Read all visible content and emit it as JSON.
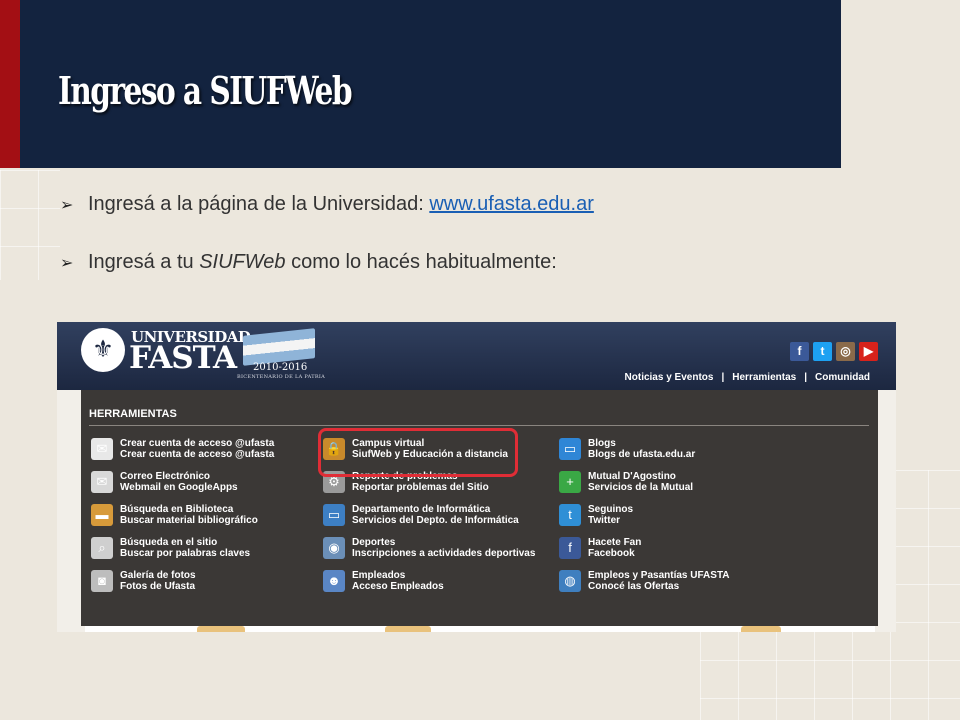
{
  "slide": {
    "title": "Ingreso a SIUFWeb",
    "bullet1_text": "Ingresá a la página de la Universidad: ",
    "bullet1_link": "www.ufasta.edu.ar",
    "bullet2_pre": "Ingresá a tu ",
    "bullet2_em": "SIUFWeb",
    "bullet2_post": " como lo hacés habitualmente:"
  },
  "site": {
    "logo_top": "UNIVERSIDAD",
    "logo_main": "FASTA",
    "years": "2010-2016",
    "bicentenario": "BICENTENARIO DE LA PATRIA",
    "social": [
      "f",
      "t",
      "◎",
      "▶"
    ],
    "nav": [
      "Noticias y Eventos",
      "Herramientas",
      "Comunidad"
    ],
    "nav_sep": "|",
    "menu_title": "HERRAMIENTAS",
    "items": [
      {
        "l1": "Crear cuenta de acceso @ufasta",
        "l2": "Crear cuenta de acceso @ufasta",
        "icon": "envelope-add-icon",
        "glyph": "✉",
        "color": "#e8e8e8"
      },
      {
        "l1": "Correo Electrónico",
        "l2": "Webmail en GoogleApps",
        "icon": "envelope-icon",
        "glyph": "✉",
        "color": "#d8d8d8"
      },
      {
        "l1": "Búsqueda en Biblioteca",
        "l2": "Buscar material bibliográfico",
        "icon": "folder-icon",
        "glyph": "▬",
        "color": "#d79a3a"
      },
      {
        "l1": "Búsqueda en el sitio",
        "l2": "Buscar por palabras claves",
        "icon": "search-doc-icon",
        "glyph": "⌕",
        "color": "#cfcfcf"
      },
      {
        "l1": "Galería de fotos",
        "l2": "Fotos de Ufasta",
        "icon": "camera-icon",
        "glyph": "◙",
        "color": "#bdbdbd"
      },
      {
        "l1": "Campus virtual",
        "l2": "SiufWeb y Educación a distancia",
        "icon": "lock-icon",
        "glyph": "🔒",
        "color": "#c98a2b"
      },
      {
        "l1": "Reporte de problemas",
        "l2": "Reportar problemas del Sitio",
        "icon": "gears-icon",
        "glyph": "⚙",
        "color": "#9a9a9a"
      },
      {
        "l1": "Departamento de Informática",
        "l2": "Servicios del Depto. de Informática",
        "icon": "monitor-icon",
        "glyph": "▭",
        "color": "#3d7fc4"
      },
      {
        "l1": "Deportes",
        "l2": "Inscripciones a actividades deportivas",
        "icon": "disc-icon",
        "glyph": "◉",
        "color": "#6b8fb8"
      },
      {
        "l1": "Empleados",
        "l2": "Acceso Empleados",
        "icon": "user-icon",
        "glyph": "☻",
        "color": "#5a86c5"
      },
      {
        "l1": "Blogs",
        "l2": "Blogs de ufasta.edu.ar",
        "icon": "chat-bubble-icon",
        "glyph": "▭",
        "color": "#2f86d6"
      },
      {
        "l1": "Mutual D'Agostino",
        "l2": "Servicios de la Mutual",
        "icon": "plus-circle-icon",
        "glyph": "+",
        "color": "#3aa845"
      },
      {
        "l1": "Seguinos",
        "l2": "Twitter",
        "icon": "twitter-icon",
        "glyph": "t",
        "color": "#2f8fd6"
      },
      {
        "l1": "Hacete Fan",
        "l2": "Facebook",
        "icon": "facebook-icon",
        "glyph": "f",
        "color": "#3b5998"
      },
      {
        "l1": "Empleos y Pasantías UFASTA",
        "l2": "Conocé las Ofertas",
        "icon": "globe-icon",
        "glyph": "◍",
        "color": "#3f7fbf"
      }
    ],
    "close_glyph": "✖"
  },
  "colors": {
    "title_bg": "#13233f",
    "accent_red": "#a30f14",
    "highlight": "#e02d36",
    "link": "#1a5fb4"
  }
}
